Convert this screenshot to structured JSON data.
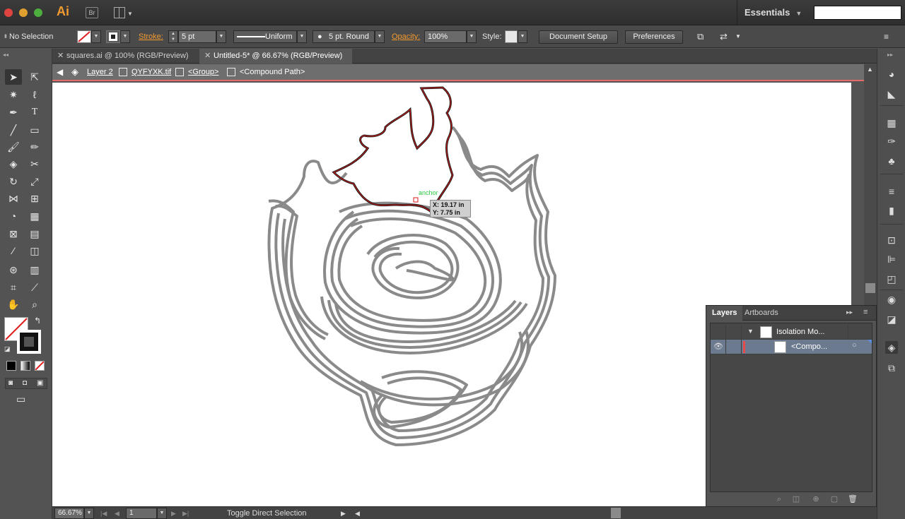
{
  "app": {
    "logo": "Ai",
    "bridge": "Br",
    "workspace": "Essentials"
  },
  "control": {
    "selection_label": "No Selection",
    "stroke_label": "Stroke:",
    "stroke_value": "5 pt",
    "profile_label": "Uniform",
    "brush_label": "5 pt. Round",
    "opacity_label": "Opacity:",
    "opacity_value": "100%",
    "style_label": "Style:",
    "document_setup": "Document Setup",
    "preferences": "Preferences"
  },
  "tabs": [
    {
      "label": "squares.ai @ 100% (RGB/Preview)",
      "active": false
    },
    {
      "label": "Untitled-5* @ 66.67% (RGB/Preview)",
      "active": true
    }
  ],
  "isolation": {
    "crumbs": [
      "Layer 2",
      "QYFYXK.tif",
      "<Group>",
      "<Compound Path>"
    ]
  },
  "canvas": {
    "anchor_label": "anchor",
    "coord_x": "X: 19.17 in",
    "coord_y": "Y: 7.75 in"
  },
  "status": {
    "zoom": "66.67%",
    "artboard": "1",
    "toggle": "Toggle Direct Selection"
  },
  "layers_panel": {
    "tab_layers": "Layers",
    "tab_artboards": "Artboards",
    "rows": [
      {
        "name": "Isolation Mo...",
        "selected": false
      },
      {
        "name": "<Compo...",
        "selected": true
      }
    ]
  },
  "colors": {
    "accent_orange": "#f29a2e",
    "isolation_border": "#e66a6a",
    "path_red": "#d81b1b",
    "stroke_gray": "#808080",
    "layer_color": "#e74c4c"
  }
}
